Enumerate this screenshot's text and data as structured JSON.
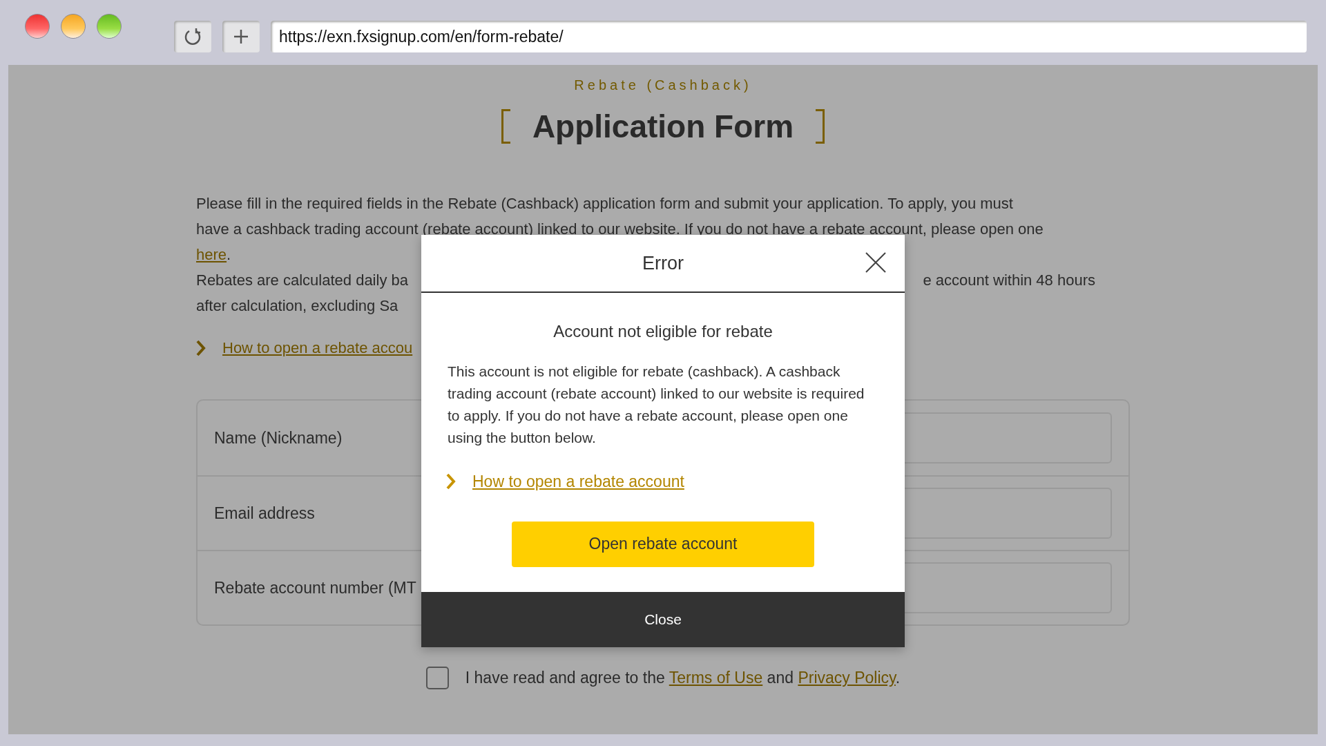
{
  "browser": {
    "url": "https://exn.fxsignup.com/en/form-rebate/"
  },
  "page": {
    "eyebrow": "Rebate (Cashback)",
    "title": "Application Form",
    "intro": [
      {
        "kind": "text",
        "text": "Please fill in the required fields in the Rebate (Cashback) application form and submit your application. To apply, you must"
      },
      {
        "kind": "text",
        "text": "have a cashback trading account (rebate account) linked to our website. If you do not have a rebate account, please open one"
      },
      {
        "kind": "link",
        "text": "here",
        "after": "."
      },
      {
        "kind": "split",
        "text": "Rebates are calculated daily ba",
        "right": "e account within 48 hours"
      },
      {
        "kind": "text",
        "text": "after calculation, excluding Sa"
      }
    ],
    "guide_link": "How to open a rebate accou",
    "form_rows": [
      {
        "label": "Name (Nickname)"
      },
      {
        "label": "Email address"
      },
      {
        "label": "Rebate account number (MT"
      }
    ],
    "agree": {
      "checked": false,
      "before": "I have read and agree to the ",
      "terms": "Terms of Use",
      "middle": " and ",
      "privacy": "Privacy Policy",
      "after": "."
    }
  },
  "modal": {
    "title": "Error",
    "heading": "Account not eligible for rebate",
    "message": "This account is not eligible for rebate (cashback). A cashback trading account (rebate account) linked to our website is required to apply. If you do not have a rebate account, please open one using the button below.",
    "link": "How to open a rebate account",
    "primary_button": "Open rebate account",
    "close_button": "Close"
  }
}
